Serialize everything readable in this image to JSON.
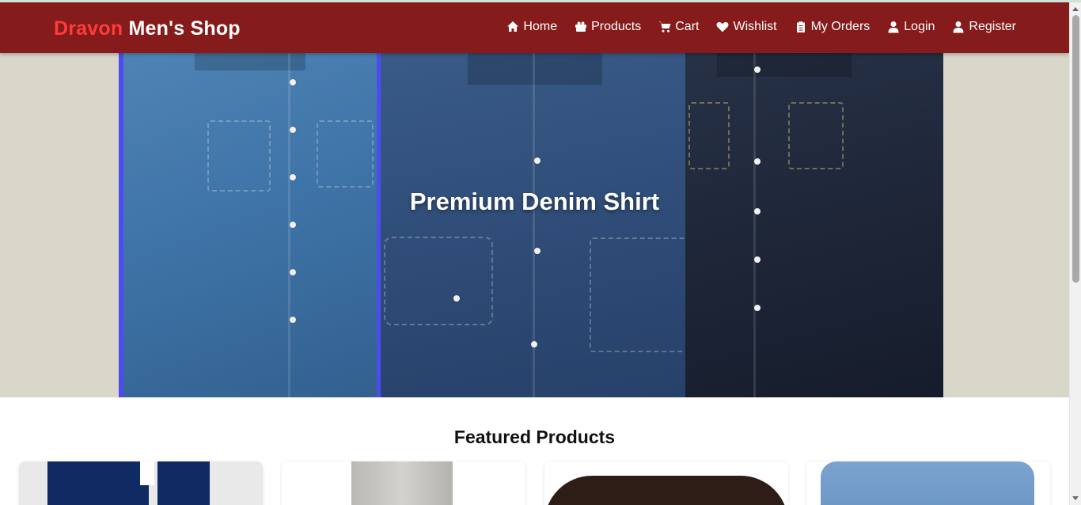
{
  "brand": {
    "part1": "Dravon",
    "part2": "Men's Shop"
  },
  "nav": [
    {
      "label": "Home",
      "icon": "home-icon"
    },
    {
      "label": "Products",
      "icon": "gift-icon"
    },
    {
      "label": "Cart",
      "icon": "cart-icon"
    },
    {
      "label": "Wishlist",
      "icon": "heart-icon"
    },
    {
      "label": "My Orders",
      "icon": "clipboard-icon"
    },
    {
      "label": "Login",
      "icon": "user-icon"
    },
    {
      "label": "Register",
      "icon": "user-icon"
    }
  ],
  "hero": {
    "title": "Premium Denim Shirt"
  },
  "featured": {
    "title": "Featured Products",
    "cards": [
      {
        "image": "navy-shirt-image"
      },
      {
        "image": "grey-trousers-image"
      },
      {
        "image": "brown-belt-image"
      },
      {
        "image": "light-denim-shirt-image"
      }
    ]
  },
  "colors": {
    "navbar": "#861b1b",
    "brand_accent": "#ff3b3b",
    "hero_bg": "#d9d6ca"
  }
}
